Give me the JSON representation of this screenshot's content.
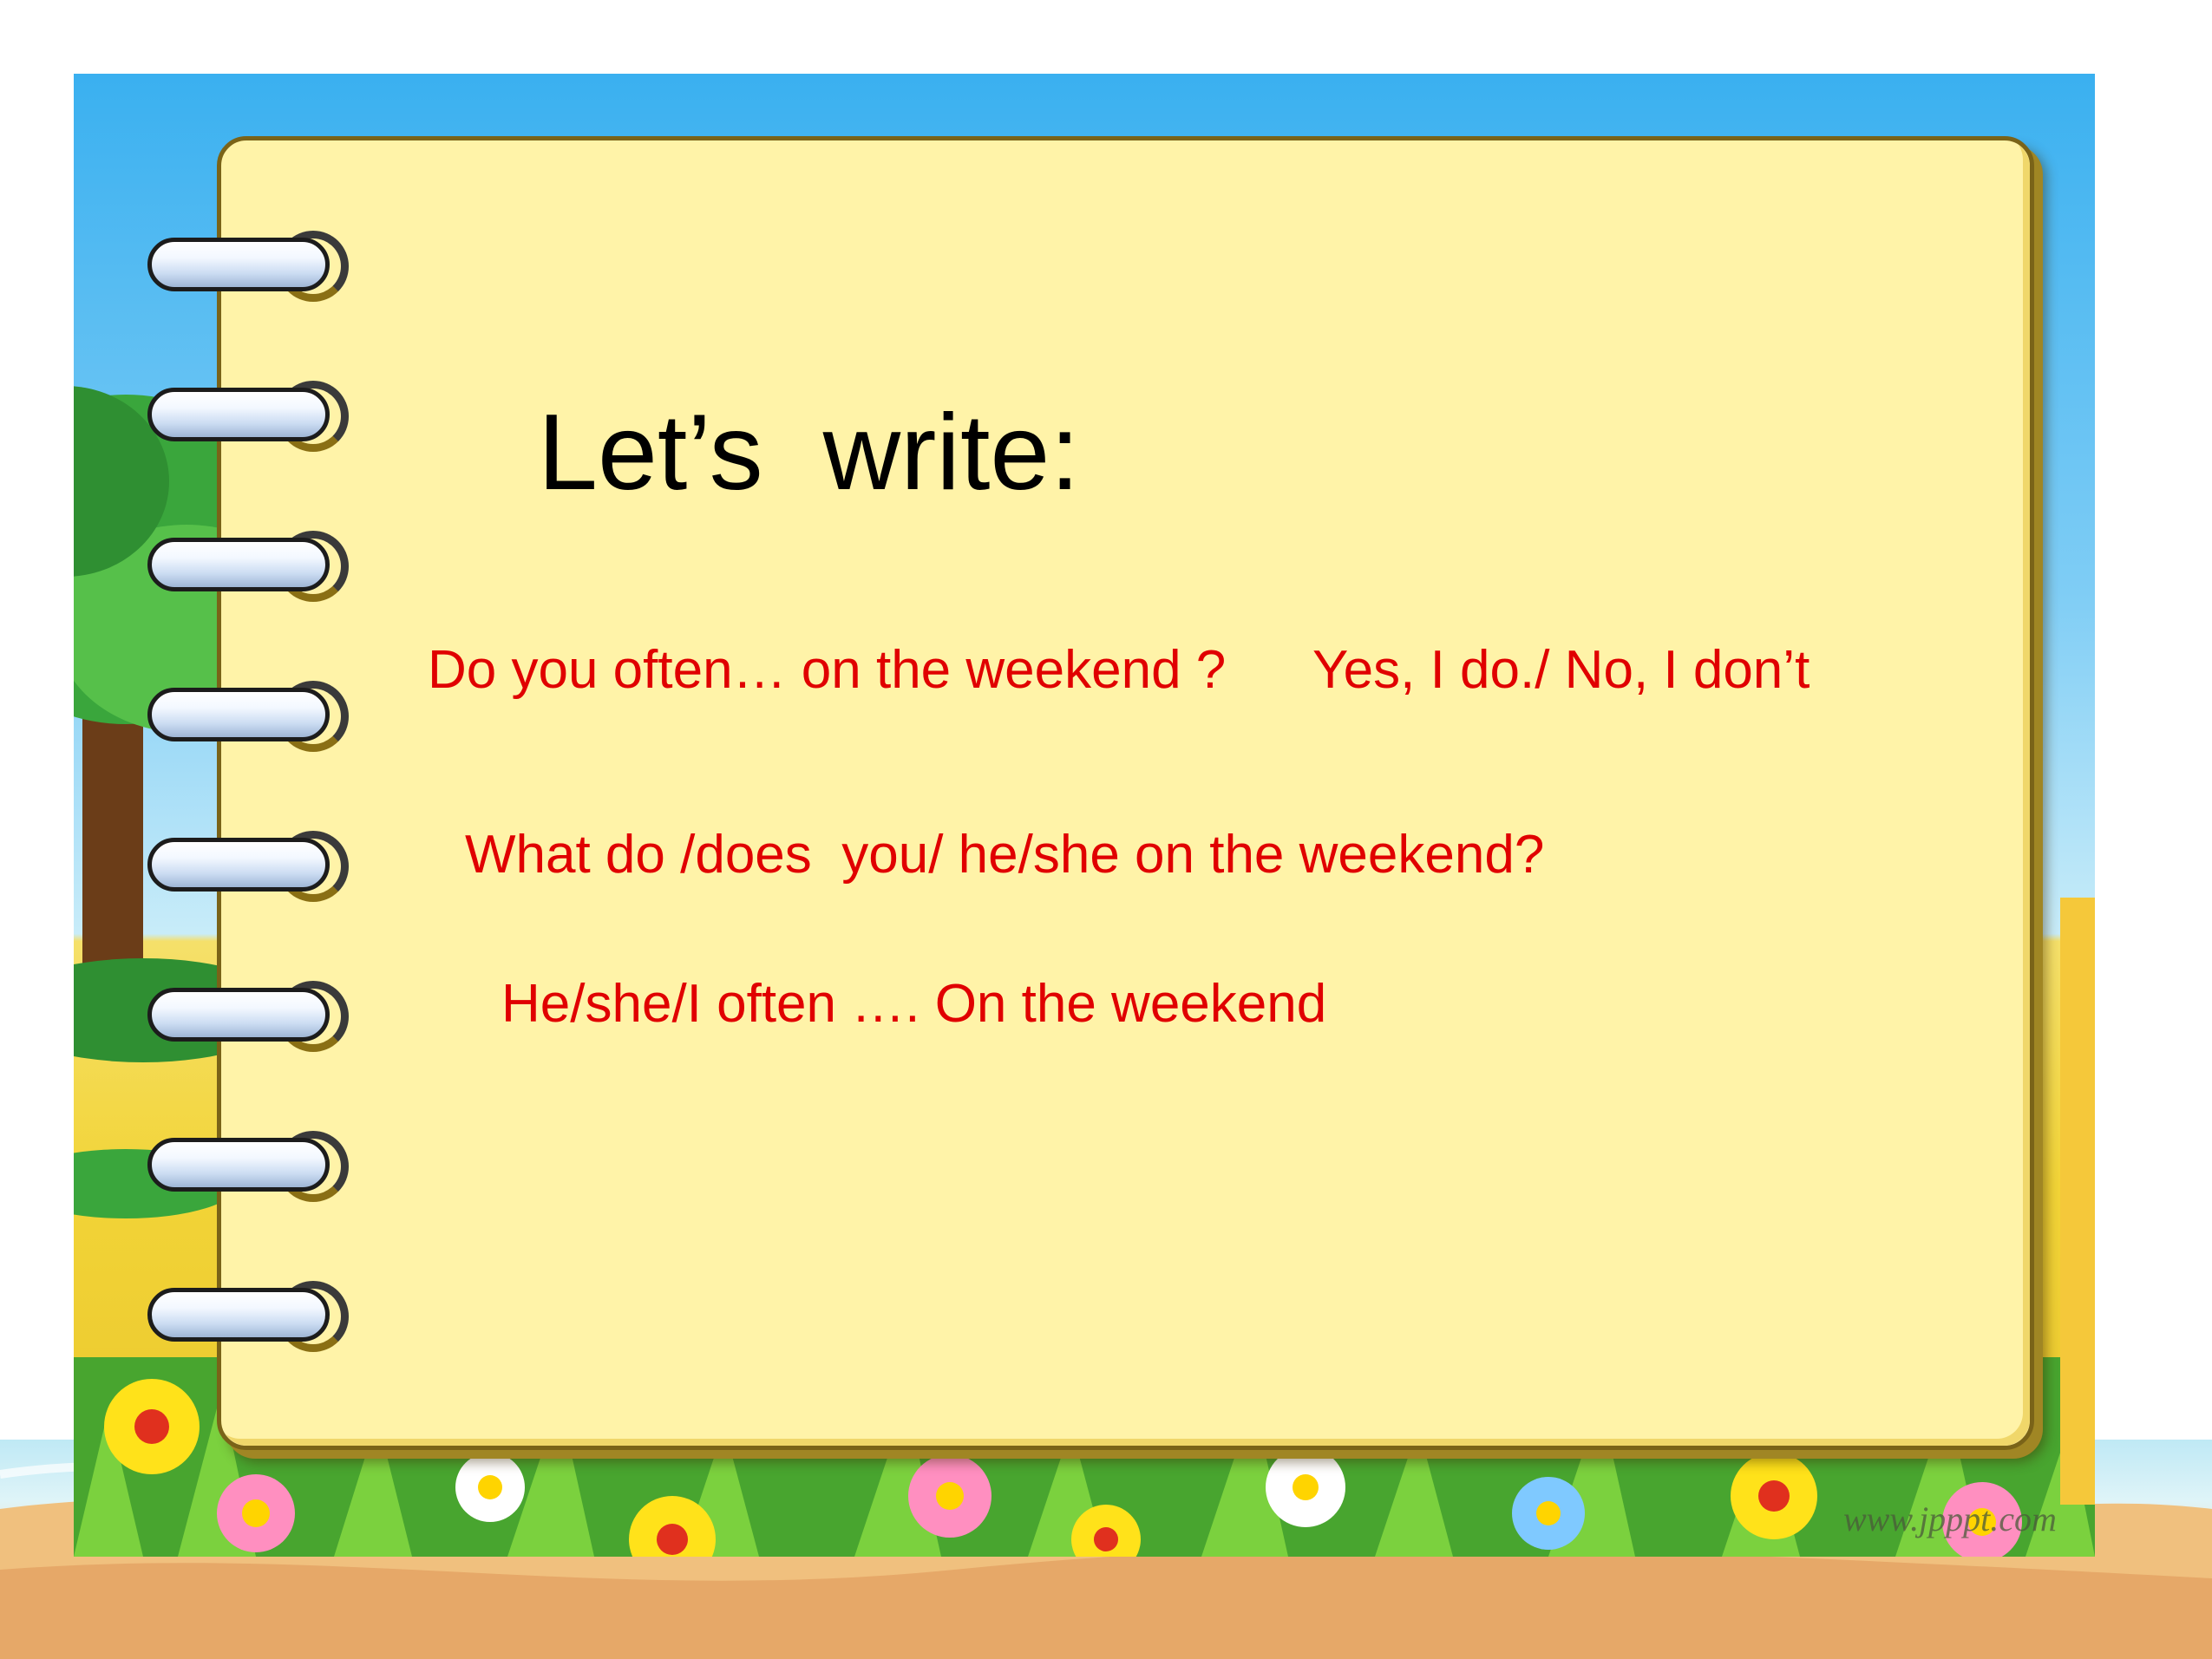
{
  "slide": {
    "title": "Let’s  write:",
    "lines": {
      "question_often": "Do you often… on the weekend ?",
      "answer_often": "Yes, I do./ No, I don’t",
      "question_what": "What do /does  you/ he/she on the weekend?",
      "answer_what": "He/she/I often …. On the weekend"
    },
    "watermark": "www.jpppt.com"
  },
  "colors": {
    "title_text": "#000000",
    "sentence_text": "#e00000",
    "notebook_paper": "#fff3a8",
    "sky": "#3ab0f0",
    "ground": "#f2d437"
  },
  "decor": {
    "spiral_ring_count": 8,
    "icons": [
      "spiral-ring-icon",
      "tree-icon",
      "flower-icon",
      "grass-icon"
    ]
  }
}
